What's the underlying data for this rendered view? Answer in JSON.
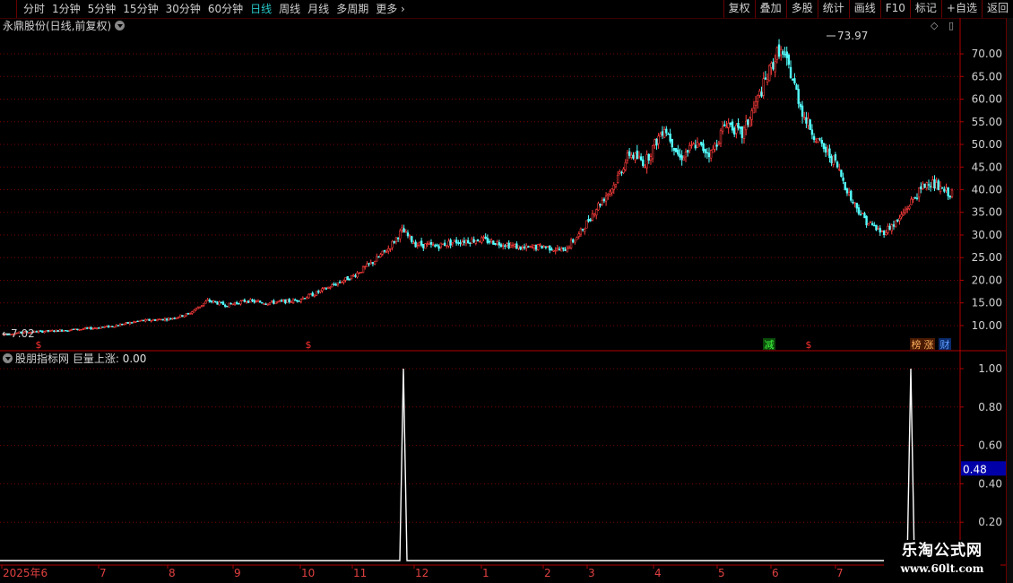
{
  "toolbar": {
    "periods": [
      {
        "label": "分时",
        "active": false
      },
      {
        "label": "1分钟",
        "active": false
      },
      {
        "label": "5分钟",
        "active": false
      },
      {
        "label": "15分钟",
        "active": false
      },
      {
        "label": "30分钟",
        "active": false
      },
      {
        "label": "60分钟",
        "active": false
      },
      {
        "label": "日线",
        "active": true
      },
      {
        "label": "周线",
        "active": false
      },
      {
        "label": "月线",
        "active": false
      },
      {
        "label": "多周期",
        "active": false
      },
      {
        "label": "更多",
        "active": false
      }
    ],
    "right_buttons": [
      "复权",
      "叠加",
      "多股",
      "统计",
      "画线",
      "F10",
      "标记",
      "+自选",
      "返回"
    ]
  },
  "stock_title": "永鼎股份(日线,前复权)",
  "indicator_title": {
    "name": "股朋指标网",
    "label": "巨量上涨:",
    "value": "0.00"
  },
  "watermark": {
    "line1": "乐淘公式网",
    "line2": "www.60lt.com"
  },
  "colors": {
    "up": "#ff3c3c",
    "down": "#54ffff",
    "grid": "#7a0000",
    "axis": "#b00000",
    "signal": "#ffffff",
    "cursor_box": "#0000a8"
  },
  "chart_data": [
    {
      "type": "candlestick",
      "ylim": [
        7.02,
        73.97
      ],
      "y_ticks": [
        "10.00",
        "15.00",
        "20.00",
        "25.00",
        "30.00",
        "35.00",
        "40.00",
        "45.00",
        "50.00",
        "55.00",
        "60.00",
        "65.00",
        "70.00"
      ],
      "high_label": "73.97",
      "low_label": "7.02",
      "x_ticks": [
        "2025年6",
        "7",
        "8",
        "9",
        "10",
        "11",
        "12",
        "1",
        "2",
        "3",
        "4",
        "5",
        "6",
        "7"
      ],
      "markers": [
        {
          "label": "$",
          "month": "6"
        },
        {
          "label": "$",
          "month": "10"
        },
        {
          "label": "减",
          "month": "5"
        },
        {
          "label": "$",
          "month": "6"
        },
        {
          "label": "榜",
          "month": "7"
        },
        {
          "label": "涨",
          "month": "7"
        },
        {
          "label": "财",
          "month": "7"
        }
      ],
      "path_points": [
        [
          0,
          8
        ],
        [
          10,
          8.5
        ],
        [
          25,
          8.8
        ],
        [
          40,
          9.2
        ],
        [
          55,
          9.8
        ],
        [
          70,
          11
        ],
        [
          85,
          11.5
        ],
        [
          95,
          12.5
        ],
        [
          105,
          15.5
        ],
        [
          115,
          14.5
        ],
        [
          125,
          15.5
        ],
        [
          135,
          15
        ],
        [
          150,
          15.5
        ],
        [
          160,
          17
        ],
        [
          170,
          19
        ],
        [
          180,
          21
        ],
        [
          190,
          24
        ],
        [
          198,
          27
        ],
        [
          205,
          31
        ],
        [
          212,
          28
        ],
        [
          222,
          27.5
        ],
        [
          232,
          28.5
        ],
        [
          245,
          29
        ],
        [
          258,
          28
        ],
        [
          268,
          27
        ],
        [
          278,
          27.5
        ],
        [
          288,
          26.5
        ],
        [
          296,
          30
        ],
        [
          305,
          36
        ],
        [
          314,
          41
        ],
        [
          322,
          48
        ],
        [
          330,
          46
        ],
        [
          340,
          54
        ],
        [
          348,
          47
        ],
        [
          356,
          50
        ],
        [
          364,
          48
        ],
        [
          372,
          55
        ],
        [
          380,
          52
        ],
        [
          388,
          60
        ],
        [
          394,
          66
        ],
        [
          399,
          71
        ],
        [
          404,
          67
        ],
        [
          412,
          56
        ],
        [
          420,
          50
        ],
        [
          428,
          46
        ],
        [
          436,
          38
        ],
        [
          444,
          33
        ],
        [
          452,
          30.5
        ],
        [
          460,
          33
        ],
        [
          468,
          38
        ],
        [
          476,
          42
        ],
        [
          482,
          40
        ],
        [
          488,
          39
        ]
      ]
    },
    {
      "type": "line",
      "series": [
        {
          "name": "巨量上涨",
          "values": [
            0,
            1,
            0,
            1,
            0
          ]
        }
      ],
      "x": [
        "",
        "11",
        "",
        "7",
        ""
      ],
      "ylim": [
        0,
        1.05
      ],
      "y_ticks": [
        "0.20",
        "0.40",
        "0.60",
        "0.80",
        "1.00"
      ],
      "cursor_value": "0.48"
    }
  ]
}
